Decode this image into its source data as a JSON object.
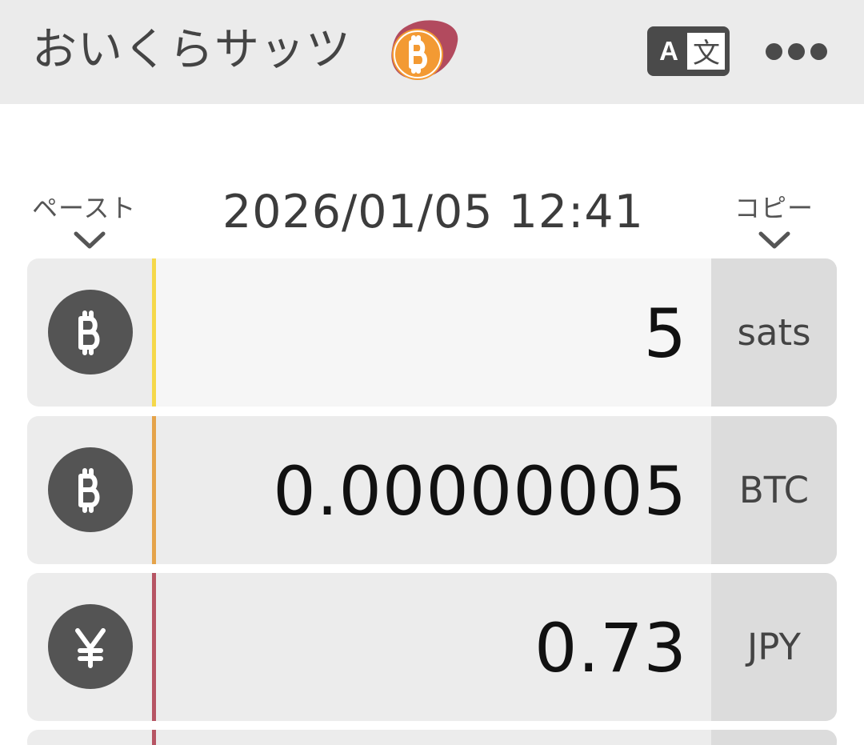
{
  "header": {
    "title": "おいくらサッツ",
    "logo_icon": "bitcoin-logo-icon",
    "translate_icon": "translate-icon",
    "more_icon": "more-horizontal-icon"
  },
  "toolbar": {
    "paste_label": "ペースト",
    "copy_label": "コピー",
    "timestamp": "2026/01/05 12:41"
  },
  "rows": [
    {
      "icon": "bitcoin-icon",
      "value": "5",
      "unit": "sats",
      "accent": "#f5d84a",
      "active": true
    },
    {
      "icon": "bitcoin-icon",
      "value": "0.00000005",
      "unit": "BTC",
      "accent": "#e5a34a",
      "active": false
    },
    {
      "icon": "yen-icon",
      "value": "0.73",
      "unit": "JPY",
      "accent": "#b65563",
      "active": false
    }
  ],
  "colors": {
    "header_bg": "#ebebeb",
    "row_bg": "#ececec",
    "active_field_bg": "#f6f6f6",
    "unit_bg": "#dcdcdc",
    "icon_bg": "#545454",
    "logo_orange": "#f39a33",
    "logo_red": "#b24a5e"
  }
}
